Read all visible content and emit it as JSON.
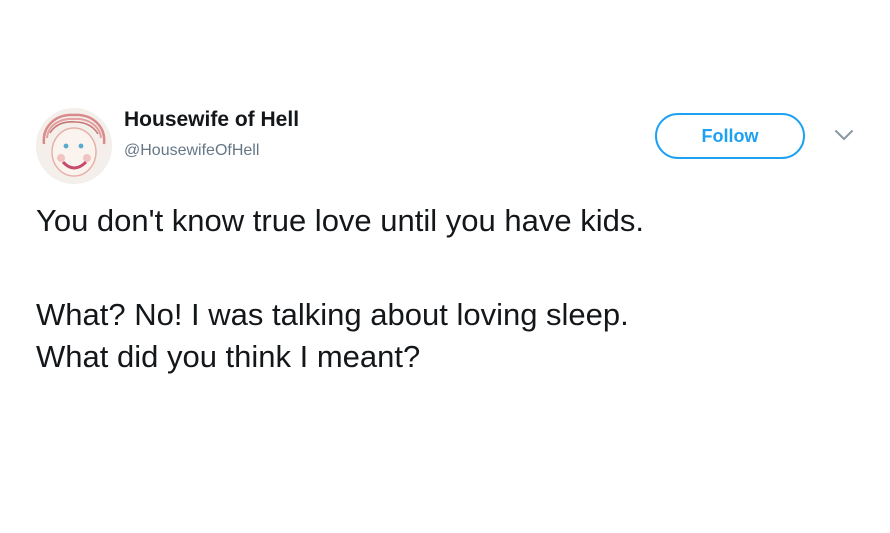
{
  "tweet": {
    "author": {
      "display_name": "Housewife of Hell",
      "handle": "@HousewifeOfHell",
      "avatar_icon": "hand-drawn-face-avatar"
    },
    "follow_label": "Follow",
    "menu_icon": "chevron-down-icon",
    "text_lines": [
      "You don't know true love until you have kids.",
      "What? No! I was talking about loving sleep.",
      "What did you think I meant?"
    ]
  },
  "colors": {
    "accent": "#1da1f2",
    "text_primary": "#14171a",
    "text_secondary": "#657786",
    "background": "#ffffff"
  }
}
